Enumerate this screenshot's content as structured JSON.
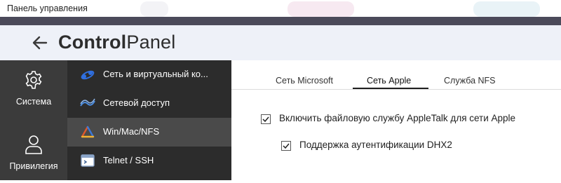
{
  "window": {
    "title": "Панель управления"
  },
  "header": {
    "title_bold": "Control",
    "title_light": "Panel"
  },
  "rail": {
    "items": [
      {
        "label": "Система",
        "icon": "gear-icon"
      },
      {
        "label": "Привилегия",
        "icon": "user-icon"
      }
    ]
  },
  "nav": {
    "items": [
      {
        "label": "Сеть и виртуальный ко...",
        "icon": "network-virtual-icon",
        "active": false
      },
      {
        "label": "Сетевой доступ",
        "icon": "network-access-icon",
        "active": false
      },
      {
        "label": "Win/Mac/NFS",
        "icon": "win-mac-nfs-icon",
        "active": true
      },
      {
        "label": "Telnet / SSH",
        "icon": "terminal-icon",
        "active": false
      }
    ]
  },
  "tabs": [
    {
      "label": "Сеть Microsoft",
      "active": false
    },
    {
      "label": "Сеть Apple",
      "active": true
    },
    {
      "label": "Служба NFS",
      "active": false
    }
  ],
  "options": {
    "appletalk": {
      "label": "Включить файловую службу AppleTalk для сети Apple",
      "checked": true
    },
    "dhx2": {
      "label": "Поддержка аутентификации DHX2",
      "checked": true
    }
  },
  "colors": {
    "rail_bg": "#3b3b3b",
    "nav_bg": "#2c2c2c",
    "nav_active_bg": "#4a4a4a",
    "header_bg": "#eef1f8"
  }
}
